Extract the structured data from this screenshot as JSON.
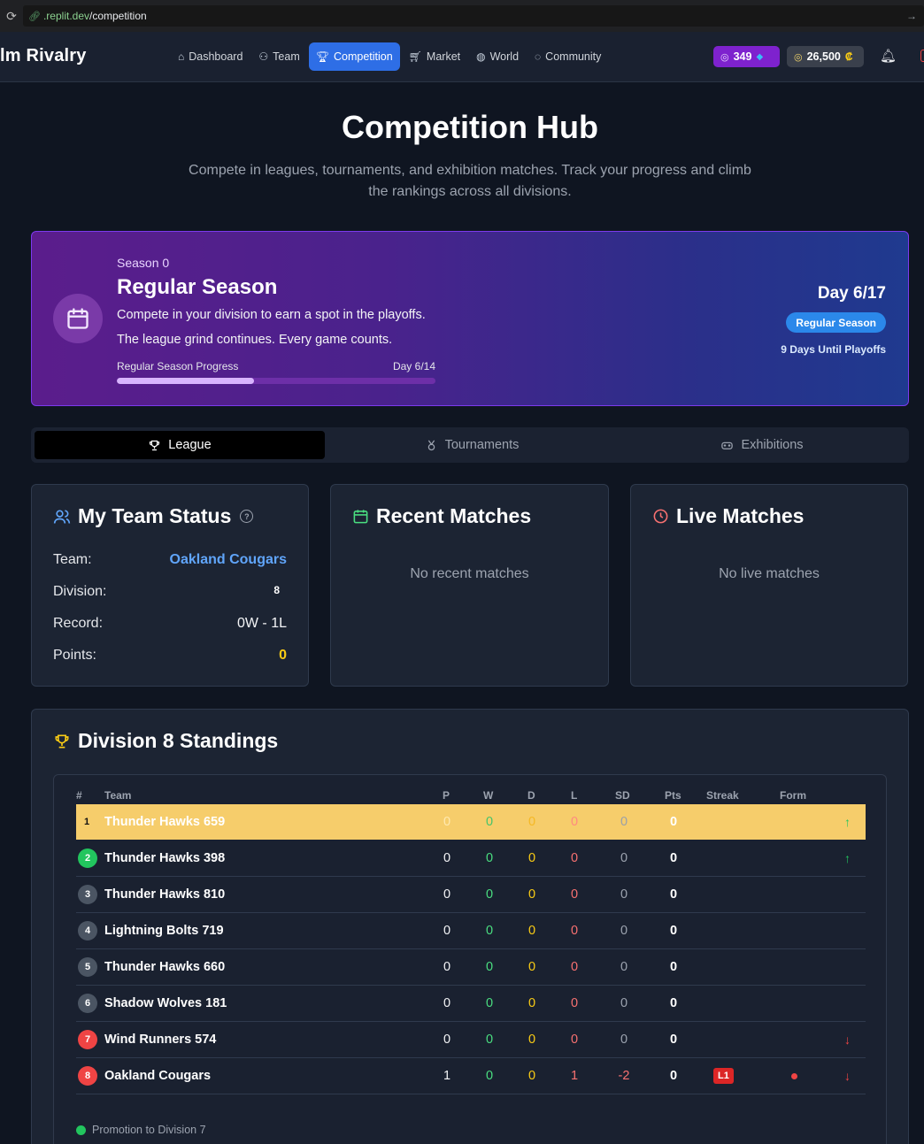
{
  "browser": {
    "url_host": ".replit.dev",
    "url_path": "/competition"
  },
  "app": {
    "brand": "lm Rivalry",
    "nav": [
      {
        "label": "Dashboard",
        "icon": "home-icon",
        "active": false
      },
      {
        "label": "Team",
        "icon": "users-icon",
        "active": false
      },
      {
        "label": "Competition",
        "icon": "trophy-icon",
        "active": true
      },
      {
        "label": "Market",
        "icon": "cart-icon",
        "active": false
      },
      {
        "label": "World",
        "icon": "globe-icon",
        "active": false
      },
      {
        "label": "Community",
        "icon": "chat-icon",
        "active": false
      }
    ],
    "gems": "349",
    "credits": "26,500",
    "credits_symbol": "₡"
  },
  "hero": {
    "title": "Competition Hub",
    "subtitle": "Compete in leagues, tournaments, and exhibition matches. Track your progress and climb the rankings across all divisions."
  },
  "season": {
    "label": "Season 0",
    "title": "Regular Season",
    "desc1": "Compete in your division to earn a spot in the playoffs.",
    "desc2": "The league grind continues. Every game counts.",
    "progress_label": "Regular Season Progress",
    "progress_day": "Day 6/14",
    "progress_fraction": 0.43,
    "day": "Day 6/17",
    "badge": "Regular Season",
    "until": "9 Days Until Playoffs"
  },
  "tabs": [
    {
      "label": "League",
      "icon": "trophy-icon",
      "active": true
    },
    {
      "label": "Tournaments",
      "icon": "medal-icon",
      "active": false
    },
    {
      "label": "Exhibitions",
      "icon": "gamepad-icon",
      "active": false
    }
  ],
  "team_status": {
    "title": "My Team Status",
    "team_label": "Team:",
    "team_value": "Oakland Cougars",
    "division_label": "Division:",
    "division_value": "8",
    "record_label": "Record:",
    "record_value": "0W - 1L",
    "points_label": "Points:",
    "points_value": "0"
  },
  "recent_matches": {
    "title": "Recent Matches",
    "empty": "No recent matches"
  },
  "live_matches": {
    "title": "Live Matches",
    "empty": "No live matches"
  },
  "standings": {
    "title": "Division 8 Standings",
    "headers": {
      "rank": "#",
      "team": "Team",
      "p": "P",
      "w": "W",
      "d": "D",
      "l": "L",
      "sd": "SD",
      "pts": "Pts",
      "streak": "Streak",
      "form": "Form"
    },
    "rows": [
      {
        "rank": "1",
        "team": "Thunder Hawks 659",
        "p": "0",
        "w": "0",
        "d": "0",
        "l": "0",
        "sd": "0",
        "pts": "0",
        "streak": "",
        "form": "",
        "trend": "↑"
      },
      {
        "rank": "2",
        "team": "Thunder Hawks 398",
        "p": "0",
        "w": "0",
        "d": "0",
        "l": "0",
        "sd": "0",
        "pts": "0",
        "streak": "",
        "form": "",
        "trend": "↑"
      },
      {
        "rank": "3",
        "team": "Thunder Hawks 810",
        "p": "0",
        "w": "0",
        "d": "0",
        "l": "0",
        "sd": "0",
        "pts": "0",
        "streak": "",
        "form": "",
        "trend": ""
      },
      {
        "rank": "4",
        "team": "Lightning Bolts 719",
        "p": "0",
        "w": "0",
        "d": "0",
        "l": "0",
        "sd": "0",
        "pts": "0",
        "streak": "",
        "form": "",
        "trend": ""
      },
      {
        "rank": "5",
        "team": "Thunder Hawks 660",
        "p": "0",
        "w": "0",
        "d": "0",
        "l": "0",
        "sd": "0",
        "pts": "0",
        "streak": "",
        "form": "",
        "trend": ""
      },
      {
        "rank": "6",
        "team": "Shadow Wolves 181",
        "p": "0",
        "w": "0",
        "d": "0",
        "l": "0",
        "sd": "0",
        "pts": "0",
        "streak": "",
        "form": "",
        "trend": ""
      },
      {
        "rank": "7",
        "team": "Wind Runners 574",
        "p": "0",
        "w": "0",
        "d": "0",
        "l": "0",
        "sd": "0",
        "pts": "0",
        "streak": "",
        "form": "",
        "trend": "↓"
      },
      {
        "rank": "8",
        "team": "Oakland Cougars",
        "p": "1",
        "w": "0",
        "d": "0",
        "l": "1",
        "sd": "-2",
        "pts": "0",
        "streak": "L1",
        "form": "L",
        "trend": "↓"
      }
    ],
    "legend_promotion": "Promotion to Division 7"
  },
  "colors": {
    "accent": "#2e6ee6",
    "promotion": "#22c55e",
    "relegation": "#ef4444",
    "neutral_rank": "#4b5563",
    "leader_row": "#f6cd6b"
  }
}
